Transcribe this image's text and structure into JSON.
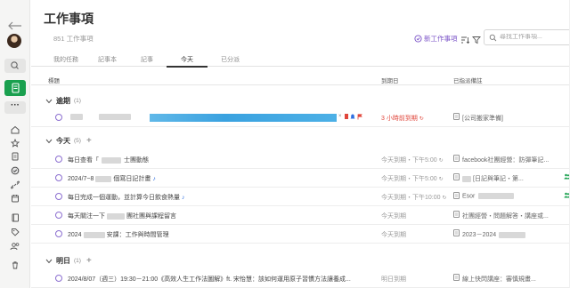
{
  "sidebar": {
    "items": [
      {
        "name": "back-icon"
      },
      {
        "name": "avatar"
      },
      {
        "name": "search-icon"
      },
      {
        "name": "new-note-icon"
      },
      {
        "name": "more-icon",
        "label": "···"
      },
      {
        "name": "home-icon"
      },
      {
        "name": "star-icon"
      },
      {
        "name": "note-icon"
      },
      {
        "name": "task-check-icon"
      },
      {
        "name": "link-icon"
      },
      {
        "name": "calendar-icon"
      },
      {
        "name": "notebook-icon"
      },
      {
        "name": "tag-icon"
      },
      {
        "name": "people-icon"
      },
      {
        "name": "trash-icon"
      }
    ]
  },
  "header": {
    "title": "工作事項",
    "task_count": "851 工作事項",
    "new_task": "新工作事項",
    "search_placeholder": "尋找工作事項..."
  },
  "tabs": [
    {
      "label": "我的任務",
      "active": false
    },
    {
      "label": "記事本",
      "active": false
    },
    {
      "label": "記事",
      "active": false
    },
    {
      "label": "今天",
      "active": true
    },
    {
      "label": "已分派",
      "active": false
    }
  ],
  "columns": {
    "title": "標題",
    "due": "到期日",
    "note": "已指派備註"
  },
  "sections": {
    "overdue": {
      "label": "逾期",
      "count": "(1)"
    },
    "today": {
      "label": "今天",
      "count": "(5)"
    },
    "tomorrow": {
      "label": "明日",
      "count": "(1)"
    }
  },
  "rows": {
    "overdue": [
      {
        "name": "",
        "due": "3 小時前到期",
        "note": "[公司搬家準備]"
      }
    ],
    "today": [
      {
        "name": "每日查看「",
        "name2": "士團動態",
        "due": "今天到期・下午5:00",
        "note": "facebook社團經營：防彈筆記..."
      },
      {
        "name": "2024/7~8",
        "name2": "個寫日記計畫",
        "due": "今天到期・下午5:00",
        "note": "[日記與筆記・第..."
      },
      {
        "name": "每日完成一個運動，並計算今日飲食熱量",
        "name2": "",
        "due": "今天到期・下午10:00",
        "note": "Esor"
      },
      {
        "name": "每天關注一下",
        "name2": "團社團與課程留言",
        "due": "今天到期",
        "note": "社團經營・問題解答・講座或..."
      },
      {
        "name": "2024",
        "name2": "安課：工作與時間管理",
        "due": "今天到期",
        "note": "2023－2024"
      }
    ],
    "tomorrow": [
      {
        "name": "2024/8/07（週三）19:30－21:00《高效人生工作法圖解》ft. 宋怡慧：該如何運用原子習慣方法讓養成...",
        "due": "明日到期",
        "note": "線上快閃講座：審慎規畫..."
      }
    ]
  },
  "colors": {
    "accent_purple": "#7a52c7",
    "green": "#1aa04f",
    "overdue_red": "#e0463b",
    "highlight_blue": "#3aa2e0"
  }
}
